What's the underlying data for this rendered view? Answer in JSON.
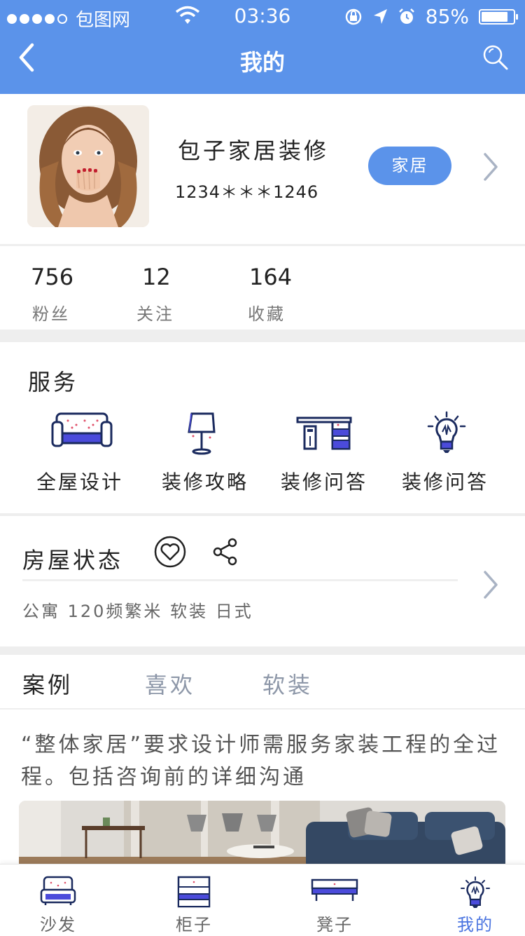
{
  "status_bar": {
    "carrier": "包图网",
    "time": "03:36",
    "battery_percent": "85%",
    "battery_level": 0.85
  },
  "nav": {
    "title": "我的",
    "back_icon": "chevron-left-icon",
    "search_icon": "search-icon"
  },
  "profile": {
    "name": "包子家居装修",
    "phone": "1234＊＊＊1246",
    "tag_button": "家居"
  },
  "stats": [
    {
      "value": "756",
      "label": "粉丝"
    },
    {
      "value": "12",
      "label": "关注"
    },
    {
      "value": "164",
      "label": "收藏"
    }
  ],
  "services": {
    "title": "服务",
    "items": [
      {
        "label": "全屋设计",
        "icon": "sofa-icon"
      },
      {
        "label": "装修攻略",
        "icon": "lamp-icon"
      },
      {
        "label": "装修问答",
        "icon": "desk-icon"
      },
      {
        "label": "装修问答",
        "icon": "lightbulb-icon"
      }
    ]
  },
  "house_status": {
    "title": "房屋状态",
    "detail": "公寓 120频繁米 软装 日式"
  },
  "tabs": [
    {
      "label": "案例",
      "active": true
    },
    {
      "label": "喜欢",
      "active": false
    },
    {
      "label": "软装",
      "active": false
    }
  ],
  "article": {
    "text": "“整体家居”要求设计师需服务家装工程的全过程。包括咨询前的详细沟通"
  },
  "tabbar": [
    {
      "label": "沙发",
      "icon": "sofa-icon",
      "active": false
    },
    {
      "label": "柜子",
      "icon": "cabinet-icon",
      "active": false
    },
    {
      "label": "凳子",
      "icon": "bench-icon",
      "active": false
    },
    {
      "label": "我的",
      "icon": "lightbulb-icon",
      "active": true
    }
  ],
  "colors": {
    "primary": "#5b93ea",
    "tab_active": "#4a74e0",
    "icon_navy": "#1a2a5e",
    "icon_fill": "#4b4bdb"
  }
}
